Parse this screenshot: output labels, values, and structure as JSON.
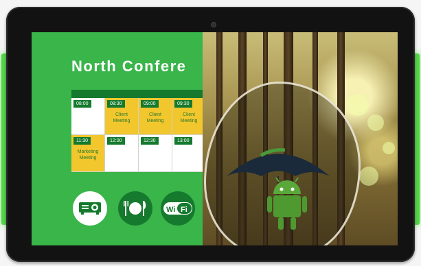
{
  "room": {
    "title": "North Confere"
  },
  "schedule": {
    "slots": [
      {
        "time": "08:00",
        "meeting": ""
      },
      {
        "time": "08:30",
        "meeting": "Client\nMeeting"
      },
      {
        "time": "09:00",
        "meeting": "Client\nMeeting"
      },
      {
        "time": "09:30",
        "meeting": "Client\nMeeting"
      },
      {
        "time": "11:30",
        "meeting": "Marketing\nMeeting"
      },
      {
        "time": "12:00",
        "meeting": ""
      },
      {
        "time": "12:30",
        "meeting": ""
      },
      {
        "time": "13:00",
        "meeting": ""
      }
    ]
  },
  "amenities": {
    "projector": "projector-icon",
    "dining": "dining-icon",
    "wifi": "wifi-icon",
    "wifi_label_left": "Wi",
    "wifi_label_right": "Fi"
  },
  "colors": {
    "panel_green": "#39b54a",
    "dark_green": "#157a2e",
    "booked_yellow": "#f2c72e",
    "led_green": "#55d44a"
  }
}
